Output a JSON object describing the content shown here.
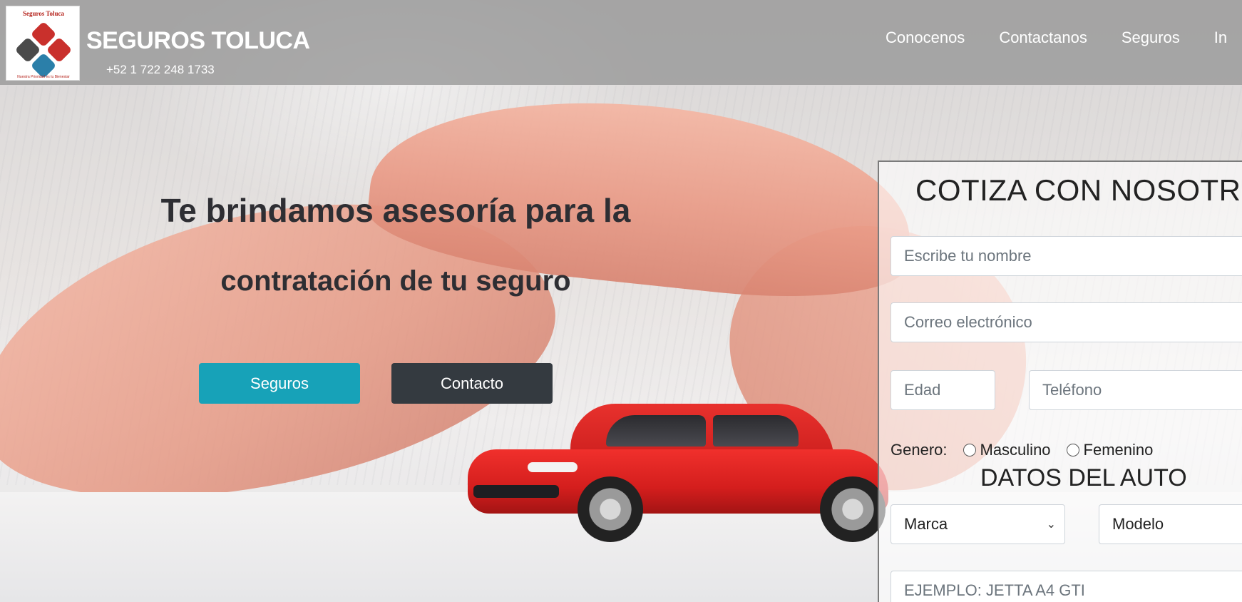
{
  "header": {
    "logo": {
      "title": "Seguros Toluca",
      "slogan": "Nuestra Prioridad es tu Bienestar"
    },
    "brand": "SEGUROS TOLUCA",
    "phone": "+52 1 722 248 1733",
    "nav": [
      {
        "label": "Conocenos"
      },
      {
        "label": "Contactanos"
      },
      {
        "label": "Seguros"
      },
      {
        "label": "In"
      }
    ]
  },
  "hero": {
    "line1": "Te brindamos asesoría para la",
    "line2": "contratación de tu seguro",
    "buttons": {
      "seguros": "Seguros",
      "contacto": "Contacto"
    }
  },
  "form": {
    "title": "COTIZA CON NOSOTROS",
    "nombre_placeholder": "Escribe tu nombre",
    "correo_placeholder": "Correo electrónico",
    "edad_placeholder": "Edad",
    "telefono_placeholder": "Teléfono",
    "genero_label": "Genero:",
    "genero_options": [
      "Masculino",
      "Femenino"
    ],
    "datos_title": "DATOS DEL AUTO",
    "marca_selected": "Marca",
    "modelo_selected": "Modelo",
    "version_placeholder": "EJEMPLO: JETTA A4 GTI"
  },
  "colors": {
    "accent": "#17a2b8",
    "dark_button": "#343a40",
    "brand_red": "#b5231c"
  },
  "icons": {
    "select_chevron": "chevron-down-icon"
  }
}
